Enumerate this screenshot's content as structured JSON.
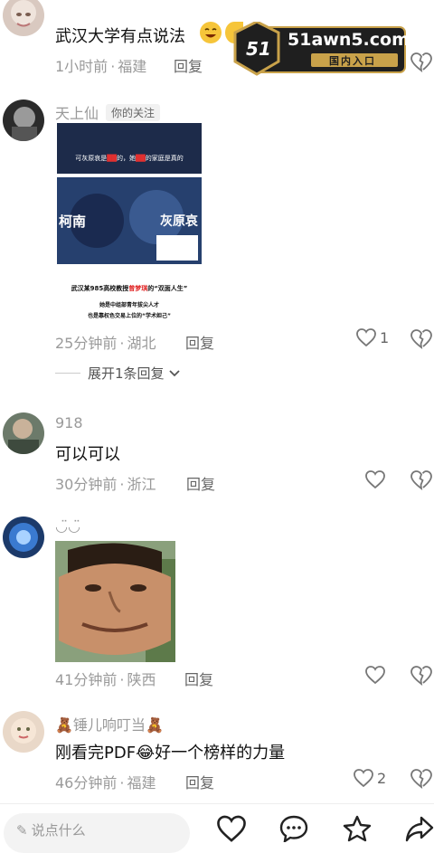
{
  "comments": [
    {
      "text": "武汉大学有点说法",
      "time": "1小时前",
      "location": "福建",
      "reply_label": "回复"
    },
    {
      "username": "天上仙",
      "tag": "你的关注",
      "image_texts": {
        "header_pre": "可灰原哀是",
        "header_mid": "的，她",
        "header_post": "的家庭是真的",
        "name_left": "柯南",
        "name_right": "灰原哀",
        "line1_pre": "武汉某985高校教授",
        "line1_name": "曾梦琪",
        "line1_post": "的“双面人生”",
        "line2": "她是中组部青年拔尖人才",
        "line3": "也是靠权色交易上位的“学术妲己”"
      },
      "time": "25分钟前",
      "location": "湖北",
      "reply_label": "回复",
      "likes": "1",
      "expand_label": "展开1条回复"
    },
    {
      "username": "918",
      "text": "可以可以",
      "time": "30分钟前",
      "location": "浙江",
      "reply_label": "回复"
    },
    {
      "username": "◡̈◡̈",
      "time": "41分钟前",
      "location": "陕西",
      "reply_label": "回复"
    },
    {
      "username_pre": "🧸",
      "username": "锤儿响叮当",
      "username_post": "🧸",
      "text_pre": "刚看完PDF",
      "emoji": "😂",
      "text_post": "好一个榜样的力量",
      "time": "46分钟前",
      "location": "福建",
      "reply_label": "回复",
      "likes": "2"
    }
  ],
  "ad": {
    "logo": "51",
    "domain": "51awn5.com",
    "sub": "国内入口"
  },
  "bottom": {
    "placeholder": "说点什么"
  },
  "colors": {
    "ad_gold": "#c9a24a",
    "ad_dark": "#1f1f1f"
  }
}
